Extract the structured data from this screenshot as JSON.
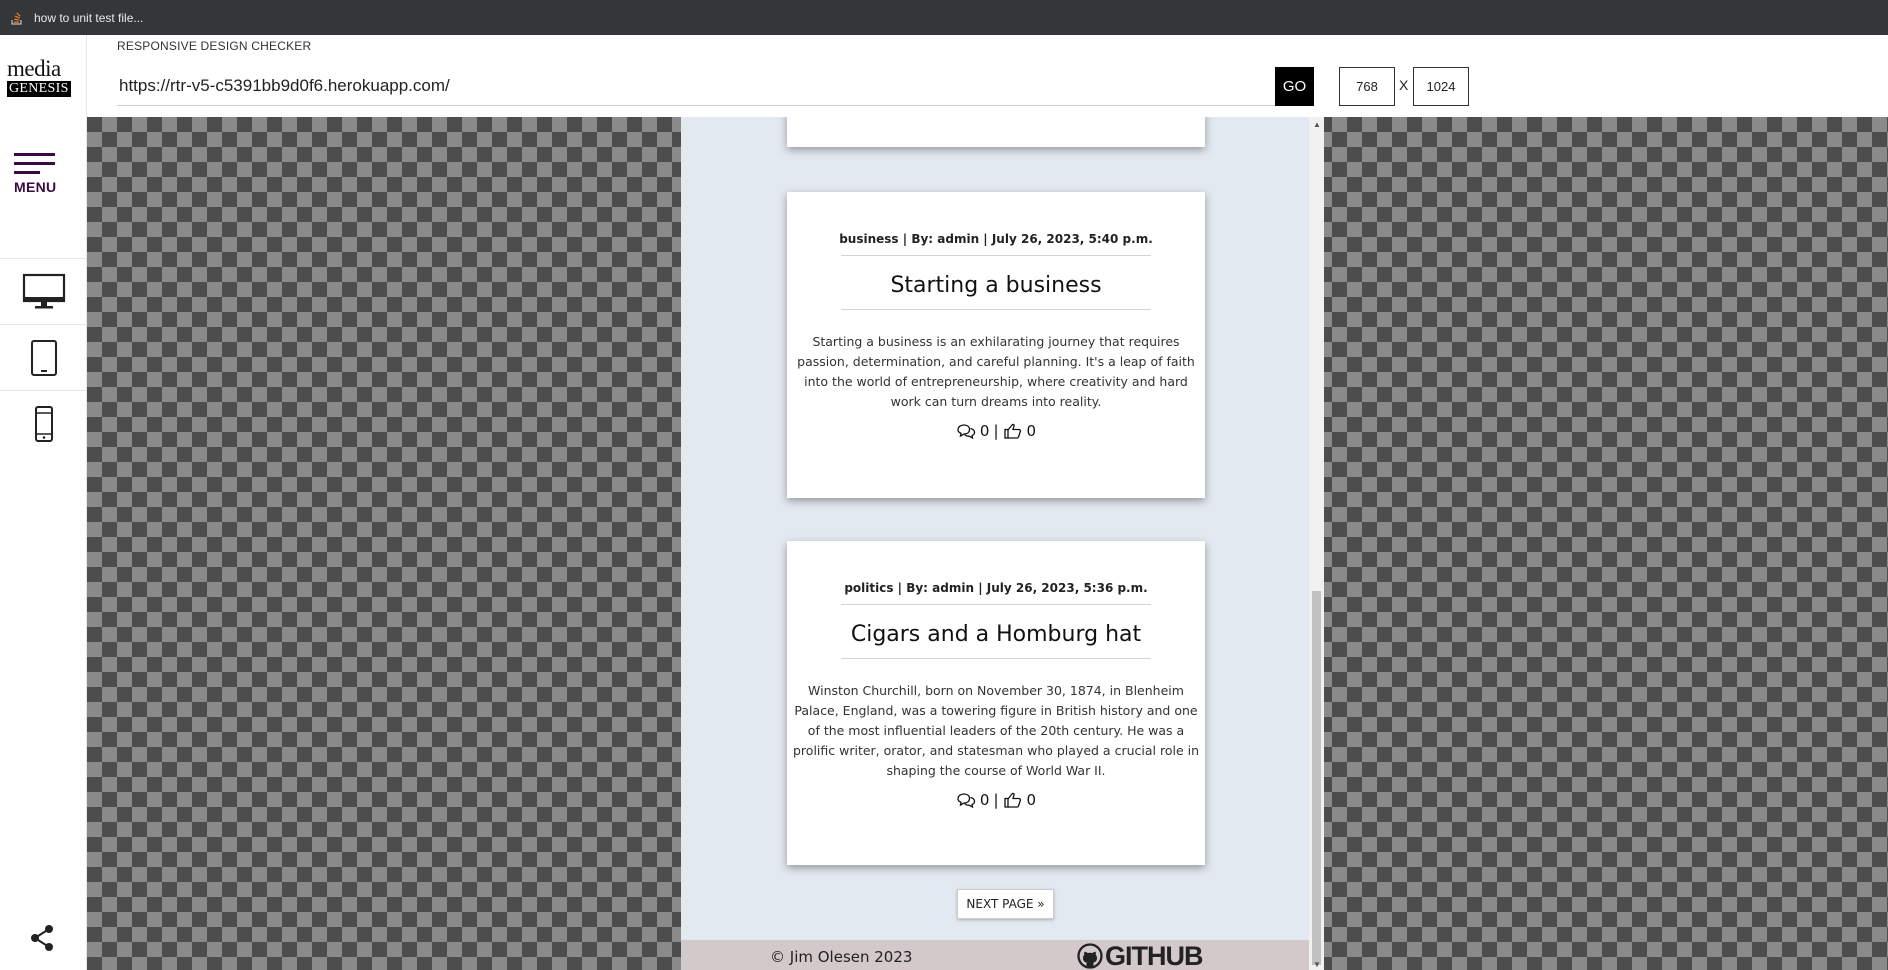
{
  "browser": {
    "tab_title": "how to unit test file..."
  },
  "sidebar": {
    "logo_top": "media",
    "logo_bottom": "GENESIS",
    "menu_label": "MENU",
    "devices": [
      "desktop-icon",
      "tablet-icon",
      "phone-icon"
    ],
    "share_icon": "share-icon"
  },
  "header": {
    "title": "RESPONSIVE DESIGN CHECKER",
    "url": "https://rtr-v5-c5391bb9d0f6.herokuapp.com/",
    "go_label": "GO",
    "width": "768",
    "x_label": "X",
    "height": "1024"
  },
  "site": {
    "posts": [
      {
        "meta": "business | By: admin | July 26, 2023, 5:40 p.m.",
        "title": "Starting a business",
        "excerpt": "Starting a business is an exhilarating journey that requires passion, determination, and careful planning. It's a leap of faith into the world of entrepreneurship, where creativity and hard work can turn dreams into reality.",
        "comments": "0",
        "likes": "0"
      },
      {
        "meta": "politics | By: admin | July 26, 2023, 5:36 p.m.",
        "title": "Cigars and a Homburg hat",
        "excerpt": "Winston Churchill, born on November 30, 1874, in Blenheim Palace, England, was a towering figure in British history and one of the most influential leaders of the 20th century. He was a prolific writer, orator, and statesman who played a crucial role in shaping the course of World War II.",
        "comments": "0",
        "likes": "0"
      }
    ],
    "separator": "|",
    "next_page": "NEXT PAGE »",
    "footer_copyright": "© Jim Olesen 2023",
    "github_label": "GITHUB"
  },
  "colors": {
    "menu_accent": "#3b0a45",
    "frame_bg": "#e3e9f0",
    "footer_bg": "#d3c8ca"
  }
}
